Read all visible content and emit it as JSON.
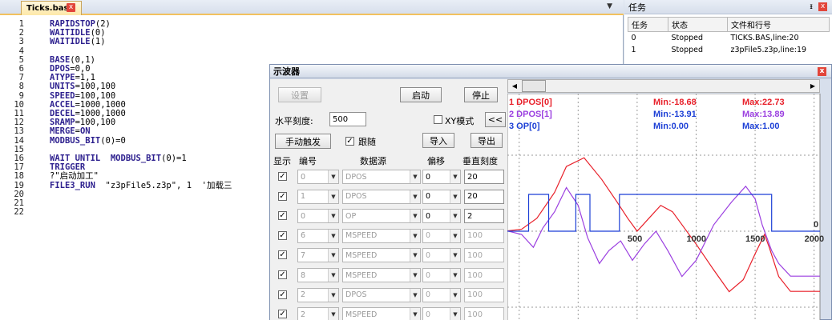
{
  "editor": {
    "tab_label": "Ticks.bas",
    "tab_close": "x",
    "dropdown": "▼",
    "lines": [
      [
        {
          "t": "RAPIDSTOP",
          "c": "kw"
        },
        {
          "t": "(2)",
          "c": ""
        }
      ],
      [
        {
          "t": "WAITIDLE",
          "c": "kw"
        },
        {
          "t": "(0)",
          "c": ""
        }
      ],
      [
        {
          "t": "WAITIDLE",
          "c": "kw"
        },
        {
          "t": "(1)",
          "c": ""
        }
      ],
      [],
      [
        {
          "t": "BASE",
          "c": "kw"
        },
        {
          "t": "(0,1)",
          "c": ""
        }
      ],
      [
        {
          "t": "DPOS",
          "c": "kw"
        },
        {
          "t": "=0,0",
          "c": ""
        }
      ],
      [
        {
          "t": "ATYPE",
          "c": "kw"
        },
        {
          "t": "=1,1",
          "c": ""
        }
      ],
      [
        {
          "t": "UNITS",
          "c": "kw"
        },
        {
          "t": "=100,100",
          "c": ""
        }
      ],
      [
        {
          "t": "SPEED",
          "c": "kw"
        },
        {
          "t": "=100,100",
          "c": ""
        }
      ],
      [
        {
          "t": "ACCEL",
          "c": "kw"
        },
        {
          "t": "=1000,1000",
          "c": ""
        }
      ],
      [
        {
          "t": "DECEL",
          "c": "kw"
        },
        {
          "t": "=1000,1000",
          "c": ""
        }
      ],
      [
        {
          "t": "SRAMP",
          "c": "kw"
        },
        {
          "t": "=100,100",
          "c": ""
        }
      ],
      [
        {
          "t": "MERGE",
          "c": "kw"
        },
        {
          "t": "=",
          "c": ""
        },
        {
          "t": "ON",
          "c": "kw"
        }
      ],
      [
        {
          "t": "MODBUS_BIT",
          "c": "kw"
        },
        {
          "t": "(0)=0",
          "c": ""
        }
      ],
      [],
      [
        {
          "t": "WAIT UNTIL  MODBUS_BIT",
          "c": "kw"
        },
        {
          "t": "(0)=1",
          "c": ""
        }
      ],
      [
        {
          "t": "TRIGGER",
          "c": "kw"
        }
      ],
      [
        {
          "t": "?\"启动加工\"",
          "c": ""
        }
      ],
      [
        {
          "t": "FILE3_RUN",
          "c": "kw"
        },
        {
          "t": "  \"z3pFile5.z3p\", 1  '加载三",
          "c": ""
        }
      ],
      [],
      [],
      []
    ]
  },
  "task_panel": {
    "title": "任务",
    "pin": "ᵻ",
    "close": "x",
    "headers": [
      "任务",
      "状态",
      "文件和行号"
    ],
    "rows": [
      [
        "0",
        "Stopped",
        "TICKS.BAS,line:20"
      ],
      [
        "1",
        "Stopped",
        "z3pFile5.z3p,line:19"
      ]
    ]
  },
  "scope": {
    "title": "示波器",
    "close": "x",
    "settings_btn": "设置",
    "start_btn": "启动",
    "stop_btn": "停止",
    "hscale_label": "水平刻度:",
    "hscale_value": "500",
    "xy_label": "XY模式",
    "collapse_btn": "<<",
    "manual_trigger_btn": "手动触发",
    "follow_label": "跟随",
    "import_btn": "导入",
    "export_btn": "导出",
    "col_show": "显示",
    "col_num": "编号",
    "col_source": "数据源",
    "col_offset": "偏移",
    "col_vscale": "垂直刻度",
    "channels": [
      {
        "num": "0",
        "source": "DPOS",
        "offset": "0",
        "vscale": "20",
        "active": true
      },
      {
        "num": "1",
        "source": "DPOS",
        "offset": "0",
        "vscale": "20",
        "active": true
      },
      {
        "num": "0",
        "source": "OP",
        "offset": "0",
        "vscale": "2",
        "active": true
      },
      {
        "num": "6",
        "source": "MSPEED",
        "offset": "0",
        "vscale": "100",
        "active": false
      },
      {
        "num": "7",
        "source": "MSPEED",
        "offset": "0",
        "vscale": "100",
        "active": false
      },
      {
        "num": "8",
        "source": "MSPEED",
        "offset": "0",
        "vscale": "100",
        "active": false
      },
      {
        "num": "2",
        "source": "DPOS",
        "offset": "0",
        "vscale": "100",
        "active": false
      },
      {
        "num": "2",
        "source": "MSPEED",
        "offset": "0",
        "vscale": "100",
        "active": false
      }
    ]
  },
  "chart_data": {
    "type": "line",
    "xlim": [
      -600,
      2050
    ],
    "x_ticks": [
      500,
      1000,
      1500,
      2000
    ],
    "zero_label": "0",
    "grid": true,
    "series": [
      {
        "name": "1 DPOS[0]",
        "min_label": "Min:-18.68",
        "max_label": "Max:22.73",
        "color": "#e8202a",
        "x": [
          -600,
          -480,
          -350,
          -200,
          -100,
          50,
          200,
          330,
          420,
          500,
          600,
          700,
          800,
          1000,
          1150,
          1280,
          1400,
          1500,
          1580,
          1620,
          1700,
          1800,
          1900,
          2050
        ],
        "y": [
          0.1,
          0.6,
          4,
          12,
          20,
          22.7,
          16,
          9,
          4,
          0,
          4,
          8,
          6,
          -4,
          -12,
          -18.7,
          -15,
          -7,
          -1,
          -5,
          -14,
          -18.6,
          -18.6,
          -18.6
        ]
      },
      {
        "name": "2 DPOS[1]",
        "min_label": "Min:-13.91",
        "max_label": "Max:13.89",
        "color": "#9b3fe0",
        "x": [
          -600,
          -480,
          -380,
          -300,
          -200,
          -100,
          0,
          80,
          180,
          260,
          360,
          460,
          560,
          660,
          760,
          880,
          1000,
          1150,
          1300,
          1420,
          1500,
          1560,
          1640,
          1700,
          1800,
          2050
        ],
        "y": [
          0.1,
          -1,
          -5,
          1,
          6,
          13.5,
          8,
          -2,
          -10,
          -6,
          -3,
          -9,
          -4,
          0,
          -6,
          -14,
          -9,
          2,
          9,
          13.9,
          10,
          2,
          -6,
          -10,
          -13.9,
          -13.9
        ]
      },
      {
        "name": "3 OP[0]",
        "min_label": "Min:0.00",
        "max_label": "Max:1.00",
        "color": "#1c3fd6",
        "x": [
          -600,
          -420,
          -420,
          -250,
          -250,
          -20,
          -20,
          100,
          100,
          350,
          350,
          1640,
          1640,
          2050
        ],
        "y": [
          0,
          0,
          1,
          1,
          0,
          0,
          1,
          1,
          0,
          0,
          1,
          1,
          0,
          0
        ]
      }
    ]
  }
}
